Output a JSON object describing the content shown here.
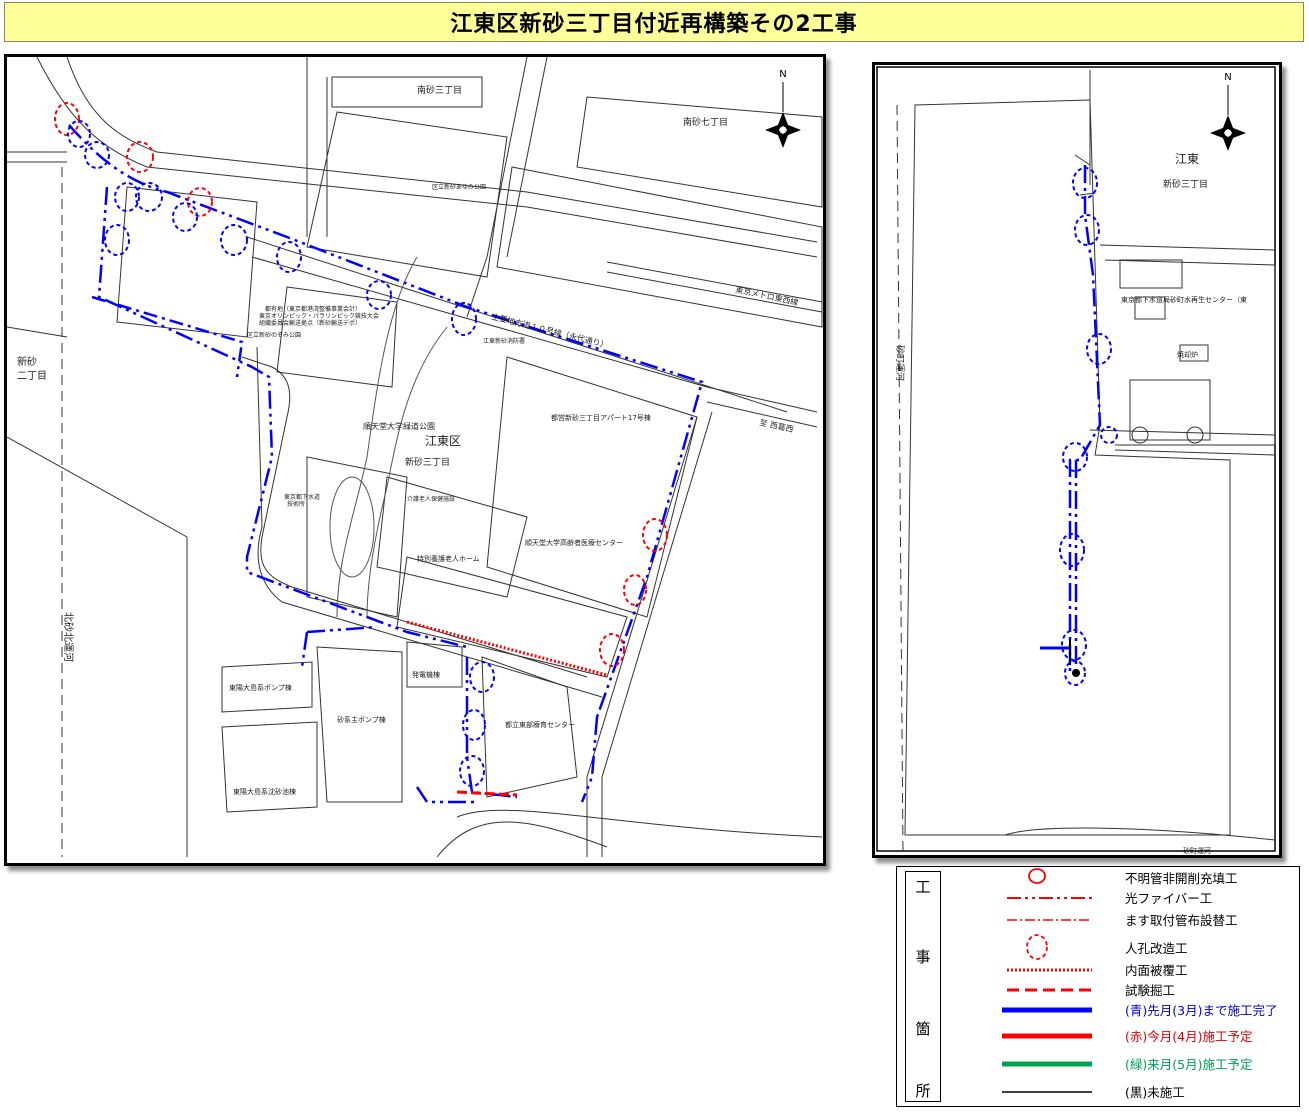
{
  "title": "江東区新砂三丁目付近再構築その2工事",
  "colors": {
    "done": "#0000ff",
    "now": "#ff0000",
    "next": "#00a050",
    "none": "#000000",
    "title_bg": "#ffff99"
  },
  "main_map": {
    "labels": {
      "minami_sana_3": "南砂三丁目",
      "minami_sana_7": "南砂七丁目",
      "shinsuna_2": "新砂\n二丁目",
      "koto_ku": "江東区",
      "shinsuna_3": "新砂三丁目",
      "metro": "東京メトロ東西線",
      "route10": "主要地方道１０号線（永代通り）",
      "west": "至 西葛西",
      "park": "順天堂大学緑道公園",
      "apartment": "都営新砂三丁目アパート17号棟",
      "medical": "順天堂大学高齢者医療センター",
      "nursing": "特別養護老人ホーム",
      "day_care": "介護老人保健施設",
      "pump": "砂系主ポンプ棟",
      "pump2": "東陽大島系ポンプ棟",
      "sand": "東陽大島系沈砂池棟",
      "generator": "発電機棟",
      "education": "都立東部療育センター",
      "kitasuna_canal": "北砂北運河",
      "ayumi_park": "区立新砂あゆみ公園",
      "olympic": "都有地（東京都港湾整備事業会計）\n東京オリンピック・パラリンピック競技大会\n組織委員会輸送拠点（新砂輸送デポ）",
      "nozomi_park": "区立新砂のぞみ公園",
      "fire": "江東新砂消防署",
      "flood": "東京都下水道\n技術所"
    }
  },
  "side_map": {
    "labels": {
      "koto": "江東",
      "shinsuna_3": "新砂三丁目",
      "center": "東京都下水道局砂町水再生センター（東",
      "incinerator": "焼却炉",
      "canal": "砂町運河",
      "canal2": "砂町運河"
    }
  },
  "legend": {
    "side": [
      "工",
      "事",
      "箇",
      "所"
    ],
    "items": [
      {
        "label": "不明管非開削充填工"
      },
      {
        "label": "光ファイバー工"
      },
      {
        "label": "ます取付管布設替工"
      },
      {
        "label": "人孔改造工"
      },
      {
        "label": "内面被覆工"
      },
      {
        "label": "試験掘工"
      },
      {
        "label": "(青)先月(3月)まで施工完了"
      },
      {
        "label": "(赤)今月(4月)施工予定"
      },
      {
        "label": "(緑)来月(5月)施工予定"
      },
      {
        "label": "(黒)未施工"
      }
    ]
  }
}
